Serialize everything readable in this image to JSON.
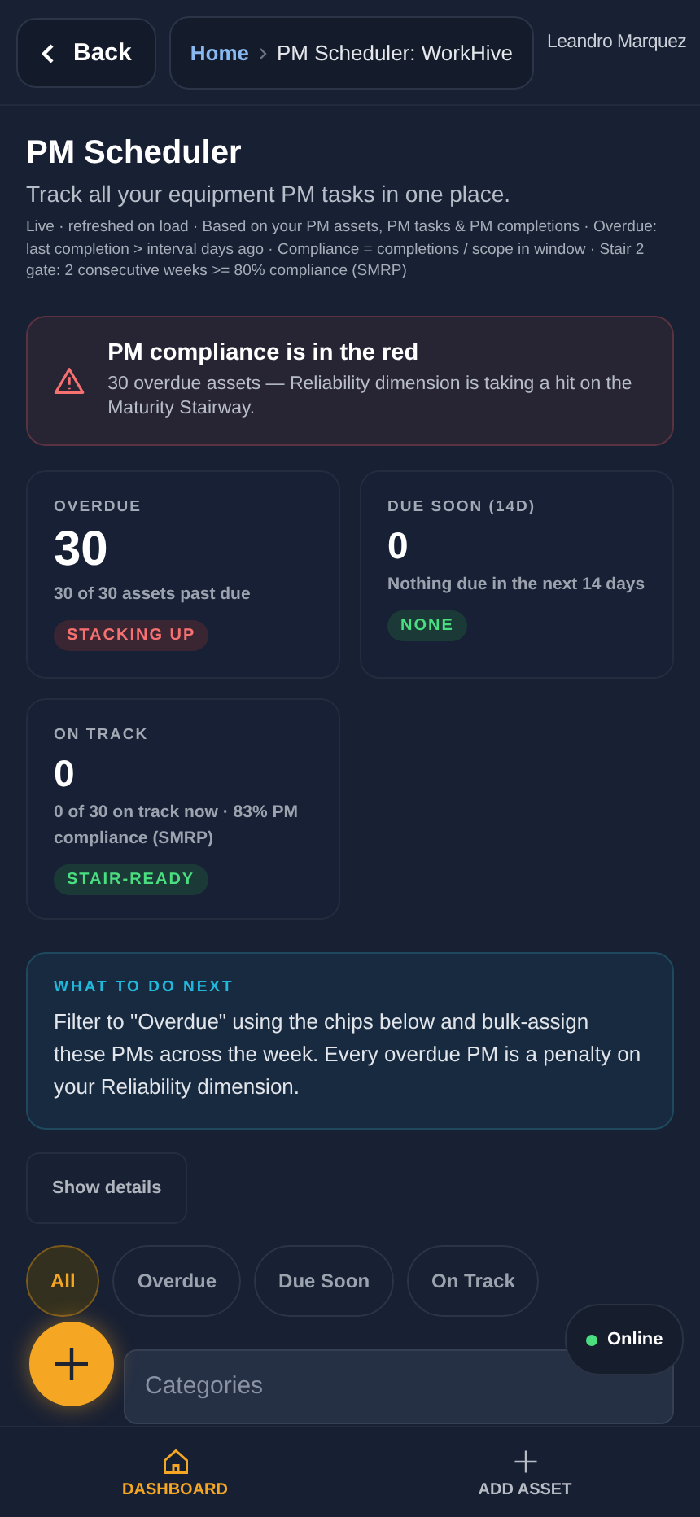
{
  "header": {
    "back_label": "Back",
    "breadcrumb": [
      "Home",
      "PM Scheduler: WorkHive"
    ],
    "user": "Leandro Marquez"
  },
  "page": {
    "title": "PM Scheduler",
    "subtitle": "Track all your equipment PM tasks in one place.",
    "meta": "Live · refreshed on load · Based on your PM assets, PM tasks & PM completions · Overdue: last completion > interval days ago · Compliance = completions / scope in window · Stair 2 gate: 2 consecutive weeks >= 80% compliance (SMRP)"
  },
  "alert": {
    "title": "PM compliance is in the red",
    "message": "30 overdue assets — Reliability dimension is taking a hit on the Maturity Stairway."
  },
  "stats": [
    {
      "label": "OVERDUE",
      "value": "30",
      "note": "30 of 30 assets past due",
      "badge": "STACKING UP",
      "kind": "danger"
    },
    {
      "label": "DUE SOON (14D)",
      "value": "0",
      "note": "Nothing due in the next 14 days",
      "badge": "NONE",
      "kind": "success"
    },
    {
      "label": "ON TRACK",
      "value": "0",
      "note": "0 of 30 on track now · 83% PM compliance (SMRP)",
      "badge": "STAIR-READY",
      "kind": "success"
    }
  ],
  "next_step": {
    "heading": "WHAT TO DO NEXT",
    "text": "Filter to \"Overdue\" using the chips below and bulk-assign these PMs across the week. Every overdue PM is a penalty on your Reliability dimension."
  },
  "details_button": "Show details",
  "filters": [
    {
      "label": "All",
      "selected": true
    },
    {
      "label": "Overdue",
      "selected": false
    },
    {
      "label": "Due Soon",
      "selected": false
    },
    {
      "label": "On Track",
      "selected": false
    }
  ],
  "category_field": {
    "placeholder": "Categories"
  },
  "status": {
    "label": "Online",
    "on": true
  },
  "nav": [
    {
      "label": "DASHBOARD",
      "kind": "home",
      "selected": true
    },
    {
      "label": "ADD ASSET",
      "kind": "plus",
      "selected": false
    }
  ]
}
